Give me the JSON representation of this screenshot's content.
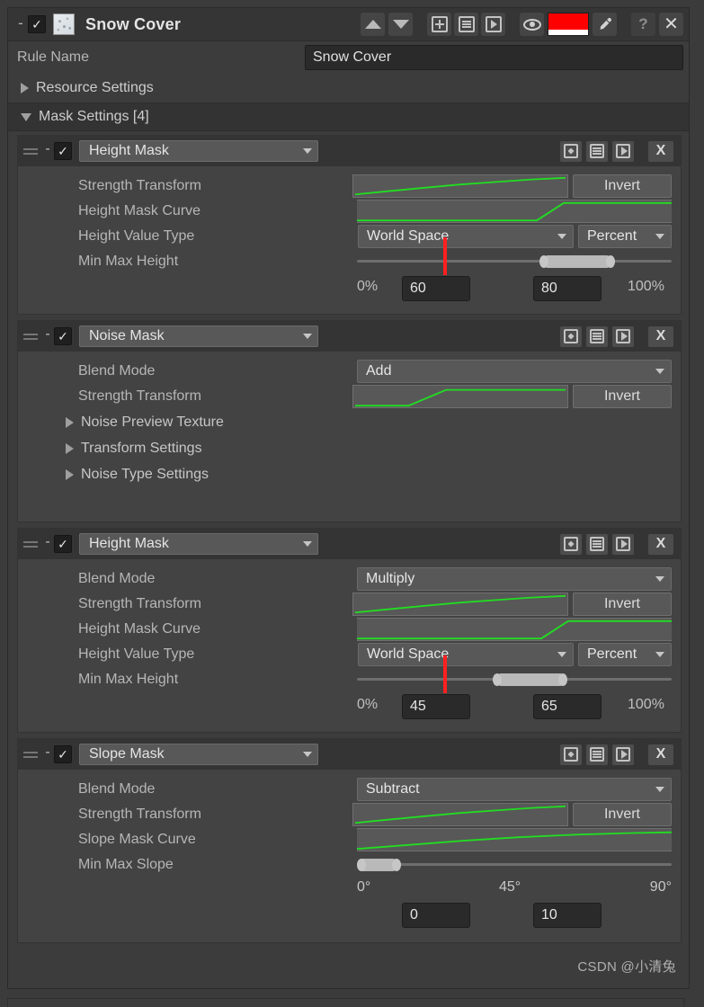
{
  "titlebar": {
    "collapse_label": "-",
    "checked": "✓",
    "title": "Snow Cover",
    "thumbnail_icon": "snow-texture-thumbnail",
    "move_up_icon": "arrow-up-icon",
    "move_down_icon": "arrow-down-icon",
    "add_icon": "add-box-icon",
    "duplicate_icon": "list-box-icon",
    "play_icon": "play-box-icon",
    "visibility_icon": "eye-icon",
    "color_swatch": "#ff0000",
    "color_alpha": "#ffffff",
    "eyedropper_icon": "eyedropper-icon",
    "help_label": "?",
    "close_label": "✕"
  },
  "rule_name": {
    "label": "Rule Name",
    "value": "Snow Cover"
  },
  "sections": {
    "resource_settings": "Resource Settings",
    "mask_settings": "Mask Settings [4]"
  },
  "common": {
    "invert": "Invert",
    "percent_min": "0%",
    "percent_max": "100%",
    "deg_min": "0°",
    "deg_mid": "45°",
    "deg_max": "90°",
    "dash": "-",
    "check": "✓",
    "close": "X"
  },
  "masks": [
    {
      "type": "Height Mask",
      "enabled": "✓",
      "collapse": "-",
      "has_blend_mode": false,
      "strength_label": "Strength Transform",
      "strength_curve": "linear-ramp",
      "curve_label": "Height Mask Curve",
      "curve_shape": "flat-then-rise",
      "value_type_label": "Height Value Type",
      "value_type": "World Space",
      "unit": "Percent",
      "minmax_label": "Min Max Height",
      "min": "60",
      "max": "80",
      "min_pct": 60,
      "max_pct": 80,
      "marker_pct": 28,
      "scale_min": "0%",
      "scale_max": "100%"
    },
    {
      "type": "Noise Mask",
      "enabled": "✓",
      "collapse": "-",
      "has_blend_mode": true,
      "blend_mode_label": "Blend Mode",
      "blend_mode": "Add",
      "strength_label": "Strength Transform",
      "strength_curve": "s-ramp",
      "foldouts": [
        "Noise Preview Texture",
        "Transform Settings",
        "Noise Type Settings"
      ]
    },
    {
      "type": "Height Mask",
      "enabled": "✓",
      "collapse": "-",
      "has_blend_mode": true,
      "blend_mode_label": "Blend Mode",
      "blend_mode": "Multiply",
      "strength_label": "Strength Transform",
      "strength_curve": "linear-ramp",
      "curve_label": "Height Mask Curve",
      "curve_shape": "flat-then-rise",
      "value_type_label": "Height Value Type",
      "value_type": "World Space",
      "unit": "Percent",
      "minmax_label": "Min Max Height",
      "min": "45",
      "max": "65",
      "min_pct": 45,
      "max_pct": 65,
      "marker_pct": 28,
      "scale_min": "0%",
      "scale_max": "100%"
    },
    {
      "type": "Slope Mask",
      "enabled": "✓",
      "collapse": "-",
      "has_blend_mode": true,
      "blend_mode_label": "Blend Mode",
      "blend_mode": "Subtract",
      "strength_label": "Strength Transform",
      "strength_curve": "linear-ramp",
      "curve_label": "Slope Mask Curve",
      "curve_shape": "gentle-rise",
      "minmax_label": "Min Max Slope",
      "min": "0",
      "max": "10",
      "min_pct": 0,
      "max_pct": 11,
      "scale_min": "0°",
      "scale_mid": "45°",
      "scale_max": "90°"
    }
  ],
  "watermark": "CSDN @小清兔"
}
